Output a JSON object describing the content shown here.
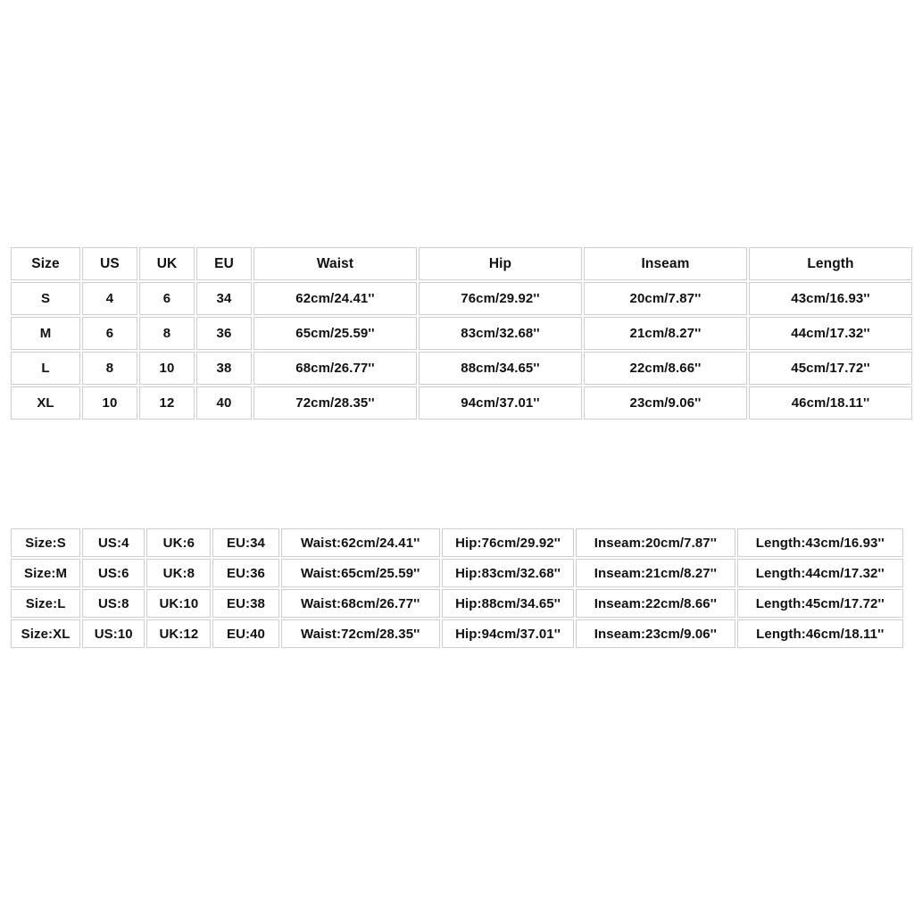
{
  "document": {
    "kind": "apparel-size-chart",
    "background_color": "#ffffff",
    "cell_border_color": "#cfcfcf",
    "text_color": "#111111"
  },
  "size_table": {
    "headers": [
      "Size",
      "US",
      "UK",
      "EU",
      "Waist",
      "Hip",
      "Inseam",
      "Length"
    ],
    "rows": [
      [
        "S",
        "4",
        "6",
        "34",
        "62cm/24.41''",
        "76cm/29.92''",
        "20cm/7.87''",
        "43cm/16.93''"
      ],
      [
        "M",
        "6",
        "8",
        "36",
        "65cm/25.59''",
        "83cm/32.68''",
        "21cm/8.27''",
        "44cm/17.32''"
      ],
      [
        "L",
        "8",
        "10",
        "38",
        "68cm/26.77''",
        "88cm/34.65''",
        "22cm/8.66''",
        "45cm/17.72''"
      ],
      [
        "XL",
        "10",
        "12",
        "40",
        "72cm/28.35''",
        "94cm/37.01''",
        "23cm/9.06''",
        "46cm/18.11''"
      ]
    ]
  },
  "labelled_table": {
    "rows": [
      [
        "Size:S",
        "US:4",
        "UK:6",
        "EU:34",
        "Waist:62cm/24.41''",
        "Hip:76cm/29.92''",
        "Inseam:20cm/7.87''",
        "Length:43cm/16.93''"
      ],
      [
        "Size:M",
        "US:6",
        "UK:8",
        "EU:36",
        "Waist:65cm/25.59''",
        "Hip:83cm/32.68''",
        "Inseam:21cm/8.27''",
        "Length:44cm/17.32''"
      ],
      [
        "Size:L",
        "US:8",
        "UK:10",
        "EU:38",
        "Waist:68cm/26.77''",
        "Hip:88cm/34.65''",
        "Inseam:22cm/8.66''",
        "Length:45cm/17.72''"
      ],
      [
        "Size:XL",
        "US:10",
        "UK:12",
        "EU:40",
        "Waist:72cm/28.35''",
        "Hip:94cm/37.01''",
        "Inseam:23cm/9.06''",
        "Length:46cm/18.11''"
      ]
    ]
  }
}
